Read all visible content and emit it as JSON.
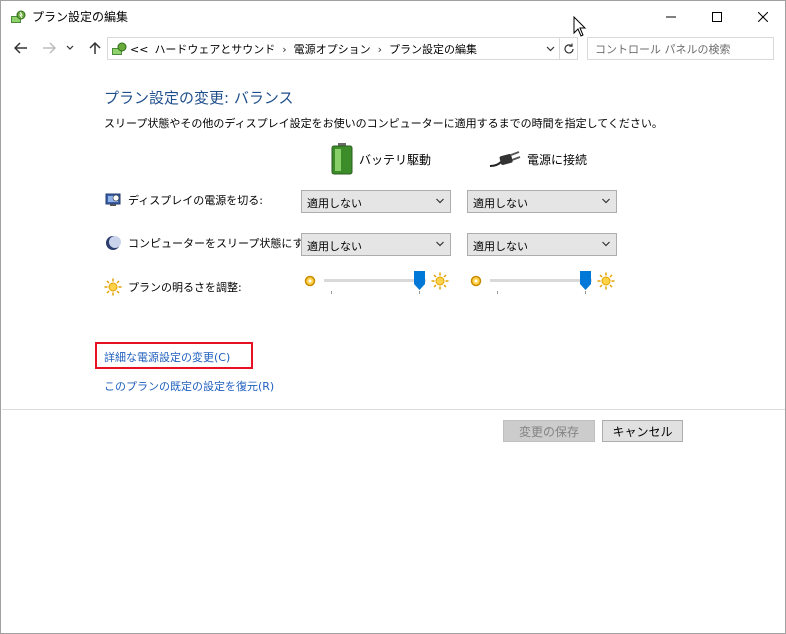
{
  "window": {
    "title": "プラン設定の編集"
  },
  "address": {
    "overflow": "<<",
    "crumbs": [
      "ハードウェアとサウンド",
      "電源オプション",
      "プラン設定の編集"
    ],
    "search_placeholder": "コントロール パネルの検索"
  },
  "main": {
    "heading": "プラン設定の変更: バランス",
    "description": "スリープ状態やその他のディスプレイ設定をお使いのコンピューターに適用するまでの時間を指定してください。",
    "columns": {
      "battery": "バッテリ駆動",
      "plugged": "電源に接続"
    },
    "rows": {
      "display_off": {
        "label": "ディスプレイの電源を切る:",
        "battery_value": "適用しない",
        "plugged_value": "適用しない"
      },
      "sleep": {
        "label": "コンピューターをスリープ状態にする:",
        "battery_value": "適用しない",
        "plugged_value": "適用しない"
      },
      "brightness": {
        "label": "プランの明るさを調整:",
        "battery_level": 1.0,
        "plugged_level": 1.0
      }
    },
    "links": {
      "advanced": "詳細な電源設定の変更(C)",
      "restore": "このプランの既定の設定を復元(R)"
    },
    "buttons": {
      "save": "変更の保存",
      "cancel": "キャンセル"
    }
  },
  "colors": {
    "heading": "#1e4e8c",
    "link": "#1f5fbf",
    "highlight_box": "#e81123",
    "slider_thumb": "#0078d7"
  },
  "icons": [
    "power-plan-icon",
    "minimize-icon",
    "maximize-icon",
    "close-icon",
    "back-arrow-icon",
    "forward-arrow-icon",
    "recent-dropdown-icon",
    "up-arrow-icon",
    "chevron-down-icon",
    "refresh-icon",
    "battery-icon",
    "power-plug-icon",
    "display-icon",
    "moon-icon",
    "sun-icon",
    "mouse-cursor-icon"
  ]
}
